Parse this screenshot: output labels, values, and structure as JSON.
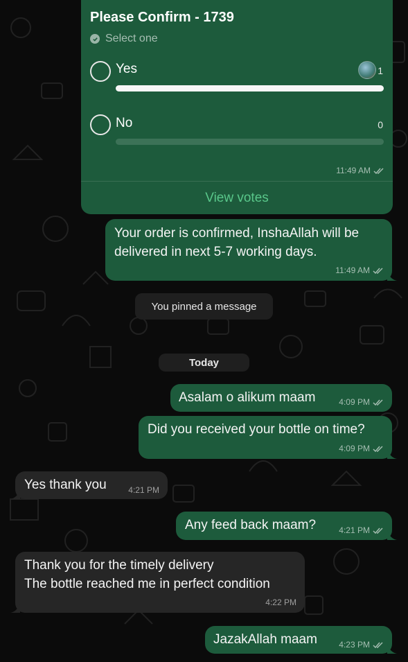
{
  "poll": {
    "title": "Please Confirm - 1739",
    "subtitle": "Select one",
    "options": [
      {
        "label": "Yes",
        "count": "1",
        "fraction": 1.0
      },
      {
        "label": "No",
        "count": "0",
        "fraction": 0.0
      }
    ],
    "time": "11:49 AM",
    "view_votes": "View votes"
  },
  "messages": [
    {
      "dir": "out",
      "text": "Your order is confirmed, InshaAllah will be delivered in next 5-7 working days.",
      "line1": "Your order is confirmed, InshaAllah will be",
      "line2": "delivered in next 5-7 working days.",
      "time": "11:49 AM"
    },
    {
      "dir": "out",
      "text": "Asalam o alikum maam",
      "time": "4:09 PM"
    },
    {
      "dir": "out",
      "text": "Did you received your bottle on time?",
      "time": "4:09 PM"
    },
    {
      "dir": "in",
      "text": "Yes thank you",
      "time": "4:21 PM"
    },
    {
      "dir": "out",
      "text": "Any feed back maam?",
      "time": "4:21 PM"
    },
    {
      "dir": "in",
      "line1": "Thank you for the timely delivery",
      "line2": "The bottle reached me in perfect condition",
      "time": "4:22 PM"
    },
    {
      "dir": "out",
      "text": "JazakAllah maam",
      "time": "4:23 PM"
    }
  ],
  "system": {
    "pinned": "You pinned a message",
    "date_divider": "Today"
  },
  "colors": {
    "background": "#0b0b0b",
    "outgoing_bubble": "#1d5b3c",
    "incoming_bubble": "#262626",
    "link_green": "#59c78a"
  },
  "icons": {
    "check": "check-circle-icon",
    "read_receipt": "double-tick-icon"
  }
}
